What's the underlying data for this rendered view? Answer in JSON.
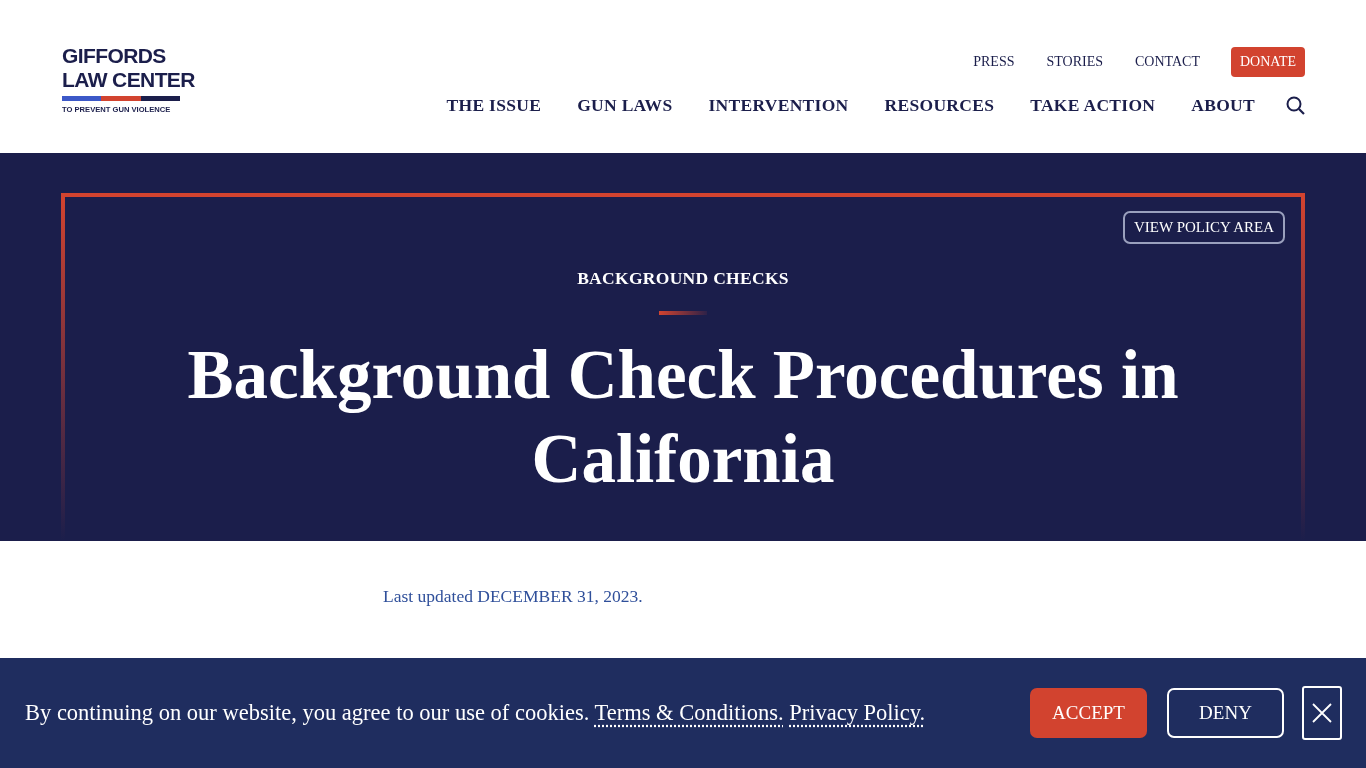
{
  "logo": {
    "lines": [
      "GIFFORDS",
      "LAW CENTER"
    ],
    "tagline": "TO PREVENT GUN VIOLENCE"
  },
  "utility_nav": [
    "PRESS",
    "STORIES",
    "CONTACT"
  ],
  "donate_button": "DONATE",
  "main_nav": [
    "THE ISSUE",
    "GUN LAWS",
    "INTERVENTION",
    "RESOURCES",
    "TAKE ACTION",
    "ABOUT"
  ],
  "hero": {
    "policy_button": "VIEW POLICY AREA",
    "eyebrow": "BACKGROUND CHECKS",
    "title": "Background Check Procedures in California"
  },
  "last_updated": "Last updated DECEMBER 31, 2023.",
  "cookie_banner": {
    "text": "By continuing on our website, you agree to our use of cookies.",
    "links": [
      "Terms & Conditions.",
      "Privacy Policy."
    ],
    "accept": "ACCEPT",
    "deny": "DENY"
  }
}
